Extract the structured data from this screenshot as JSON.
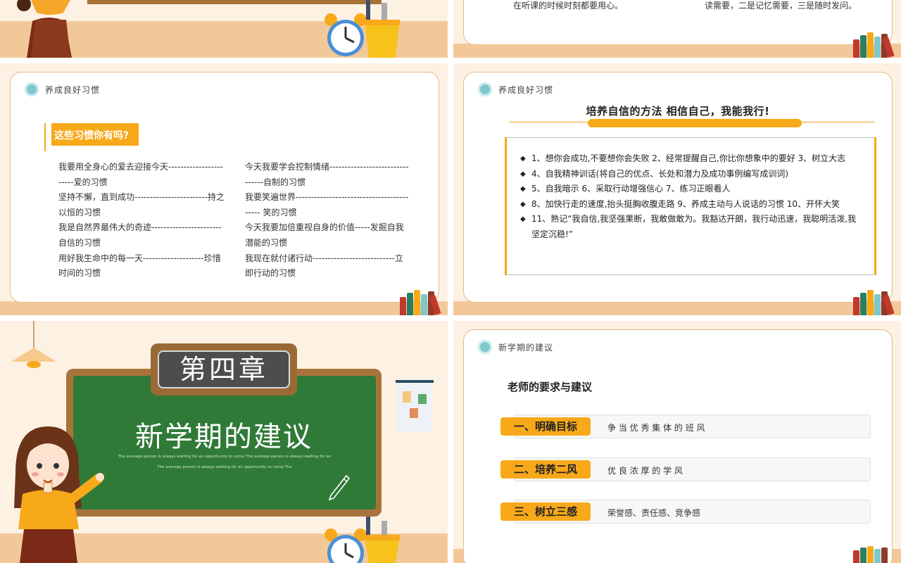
{
  "slide_top_left": {},
  "slide_top_right": {
    "fragment_left": "在听课的时候时刻都要用心。",
    "fragment_right": "读需要，二是记忆需要，三是随时发问。"
  },
  "slide_habits": {
    "section_title": "养成良好习惯",
    "question": "这些习惯你有吗?",
    "left_column": [
      "我要用全身心的爱去迎接今天-----------------------爱的习惯",
      "坚持不懈，直到成功------------------------持之以恒的习惯",
      "我是自然界最伟大的奇迹-----------------------自信的习惯",
      "用好我生命中的每一天--------------------珍惜时间的习惯"
    ],
    "right_column": [
      "今天我要学会控制情绪--------------------------------自制的习惯",
      "我要笑遍世界------------------------------------------ 笑的习惯",
      "今天我要加倍重视自身的价值-----发掘自我潜能的习惯",
      "我现在就付诸行动---------------------------立即行动的习惯"
    ]
  },
  "slide_confidence": {
    "section_title": "养成良好习惯",
    "heading": "培养自信的方法    相信自己，我能我行!",
    "items": [
      "1、想你会成功,不要想你会失败     2、经常提醒自己,你比你想象中的要好     3、树立大志",
      "4、自我精神训话(将自己的优点、长处和潜力及成功事例编写成训词)",
      "5、自我暗示      6、采取行动增强信心      7、练习正眼看人",
      "8、加快行走的速度,抬头挺胸收腹走路      9、养成主动与人说话的习惯      10、开怀大笑",
      "11、熟记“我自信,我坚强果断，我敢做敢为。我豁达开朗，我行动迅速，我聪明活泼,我坚定沉稳!”"
    ]
  },
  "slide_chapter": {
    "chapter_label": "第四章",
    "title": "新学期的建议",
    "subtitle_line1": "The average person is always waiting for an opportunity to come The average person is always waiting for an",
    "subtitle_line2": "The average person is always waiting for an opportunity to come The"
  },
  "slide_suggestions": {
    "section_title": "新学期的建议",
    "heading": "老师的要求与建议",
    "rows": [
      {
        "tag": "一、明确目标",
        "text": "争 当 优 秀 集 体 的 班 风"
      },
      {
        "tag": "二、培养二风",
        "text": "优  良  浓  厚  的  学  风"
      },
      {
        "tag": "三、树立三感",
        "text": "荣誉感、责任感、竞争感"
      }
    ]
  }
}
